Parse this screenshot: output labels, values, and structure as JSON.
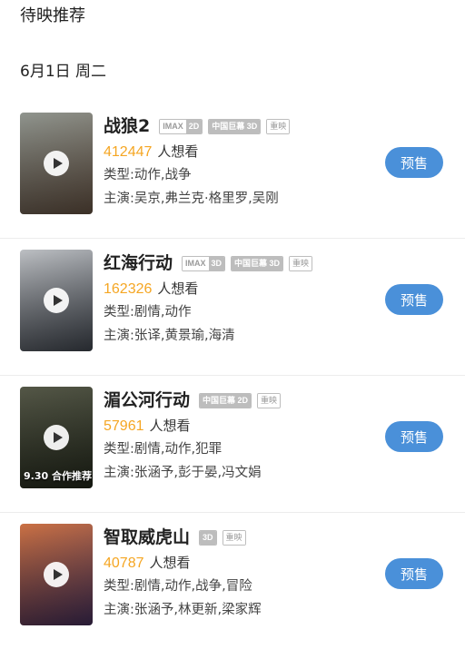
{
  "section_title": "待映推荐",
  "date_header": "6月1日 周二",
  "movies": [
    {
      "title": "战狼2",
      "badges": [
        {
          "left": "IMAX",
          "right": "2D",
          "style": "split"
        },
        {
          "left": "中国巨幕 3D",
          "right": "",
          "style": "solid"
        },
        {
          "left": "重映",
          "right": "",
          "style": "plain"
        }
      ],
      "want_count": "412447",
      "want_suffix": "人想看",
      "genre": "类型:动作,战争",
      "cast": "主演:吴京,弗兰克·格里罗,吴刚",
      "button": "预售",
      "poster_colors": [
        "#8a8f88",
        "#5b4a3c"
      ],
      "poster_caption": ""
    },
    {
      "title": "红海行动",
      "badges": [
        {
          "left": "IMAX",
          "right": "3D",
          "style": "split"
        },
        {
          "left": "中国巨幕 3D",
          "right": "",
          "style": "solid"
        },
        {
          "left": "重映",
          "right": "",
          "style": "plain"
        }
      ],
      "want_count": "162326",
      "want_suffix": "人想看",
      "genre": "类型:剧情,动作",
      "cast": "主演:张译,黄景瑜,海清",
      "button": "预售",
      "poster_colors": [
        "#b9bcc0",
        "#3a3f47"
      ],
      "poster_caption": ""
    },
    {
      "title": "湄公河行动",
      "badges": [
        {
          "left": "中国巨幕 2D",
          "right": "",
          "style": "solid"
        },
        {
          "left": "重映",
          "right": "",
          "style": "plain"
        }
      ],
      "want_count": "57961",
      "want_suffix": "人想看",
      "genre": "类型:剧情,动作,犯罪",
      "cast": "主演:张涵予,彭于晏,冯文娟",
      "button": "预售",
      "poster_colors": [
        "#4b4e3d",
        "#1f2418"
      ],
      "poster_caption": "9.30 合作推荐"
    },
    {
      "title": "智取威虎山",
      "badges": [
        {
          "left": "3D",
          "right": "",
          "style": "solid"
        },
        {
          "left": "重映",
          "right": "",
          "style": "plain"
        }
      ],
      "want_count": "40787",
      "want_suffix": "人想看",
      "genre": "类型:剧情,动作,战争,冒险",
      "cast": "主演:张涵予,林更新,梁家辉",
      "button": "预售",
      "poster_colors": [
        "#c8693a",
        "#3d2a52"
      ],
      "poster_caption": ""
    }
  ]
}
